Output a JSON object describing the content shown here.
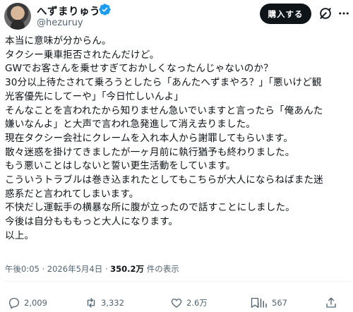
{
  "author": {
    "name": "へずまりゅう",
    "handle": "@hezuruy",
    "verified_color": "#1d9bf0"
  },
  "buttons": {
    "buy_label": "購入する"
  },
  "icons": [
    "grok-icon",
    "more-icon",
    "reply-icon",
    "repost-icon",
    "like-icon",
    "views-icon",
    "bookmark-icon",
    "share-icon"
  ],
  "tweet": {
    "lines": [
      "本当に意味が分からん。",
      "タクシー乗車拒否されたんだけど。",
      "GWでお客さんを乗せすぎておかしくなったんじゃないのか？",
      "30分以上待たされて乗ろうとしたら「あんたへずまやろ？」「悪いけど観",
      "光客優先にしてーや」「今日忙しいんよ」",
      "そんなことを言われたから知りません急いでいますと言ったら「俺あんた",
      "嫌いなんよ」と大声で言われ急発進して消え去りました。",
      "現在タクシー会社にクレームを入れ本人から謝罪してもらいます。",
      "散々迷惑を掛けてきましたが一ヶ月前に執行猶予も終わりました。",
      "もう悪いことはしないと誓い更生活動をしています。",
      "こういうトラブルは巻き込まれたとしてもこちらが大人にならねばまた迷",
      "惑系だと言われてしまいます。",
      "不快だし運転手の横暴な所に腹が立ったので話すことにしました。",
      "今後は自分もももっと大人になります。",
      "以上。"
    ]
  },
  "meta": {
    "time": "午後0:05",
    "separator": "·",
    "date": "2026年5月4日",
    "views": "350.2万",
    "views_label": "件の表示"
  },
  "actions": {
    "replies": "2,009",
    "reposts": "3,332",
    "likes": "2.6万",
    "bookmarks": "567"
  }
}
